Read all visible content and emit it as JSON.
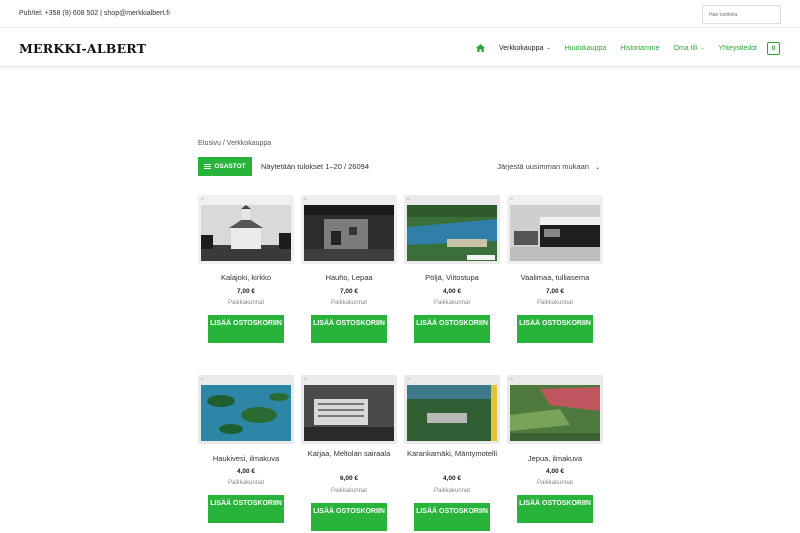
{
  "topbar": {
    "contact": "Puh/tel: +358 (9) 608 502 | shop@merkkialbert.fi",
    "search_placeholder": "Hae tuotteita"
  },
  "header": {
    "logo": "MERKKI-ALBERT",
    "nav": [
      {
        "label": "Verkkokauppa",
        "dropdown": true
      },
      {
        "label": "Huutokauppa"
      },
      {
        "label": "Historiamme"
      },
      {
        "label": "Oma tili",
        "dropdown": true
      },
      {
        "label": "Yhteystiedot"
      }
    ],
    "cart_count": "0"
  },
  "shop": {
    "breadcrumb": "Etusivu / Verkkokauppa",
    "filter_label": "OSASTOT",
    "result_count": "Näytetään tulokset 1–20 / 26094",
    "sort_label": "Järjestä uusimman mukaan"
  },
  "products": [
    {
      "title": "Kalajoki, kirkko",
      "price": "7,00 €",
      "category": "Paikkakunnat",
      "button": "LISÄÄ OSTOSKORIIN",
      "image": "bw-church"
    },
    {
      "title": "Hauho, Lepaa",
      "price": "7,00 €",
      "category": "Paikkakunnat",
      "button": "LISÄÄ OSTOSKORIIN",
      "image": "bw-building"
    },
    {
      "title": "Pöljä, Viitostupa",
      "price": "4,00 €",
      "category": "Paikkakunnat",
      "button": "LISÄÄ OSTOSKORIIN",
      "image": "color-lake-aerial"
    },
    {
      "title": "Vaalimaa, tulliasema",
      "price": "7,00 €",
      "category": "Paikkakunnat",
      "button": "LISÄÄ OSTOSKORIIN",
      "image": "bw-customs"
    },
    {
      "title": "Haukivesi, ilmakuva",
      "price": "4,00 €",
      "category": "Paikkakunnat",
      "button": "LISÄÄ OSTOSKORIIN",
      "image": "color-islands"
    },
    {
      "title": "Karjaa, Meltolan sairaala",
      "price": "6,00 €",
      "category": "Paikkakunnat",
      "button": "LISÄÄ OSTOSKORIIN",
      "image": "bw-hospital"
    },
    {
      "title": "Karankamäki, Mäntymotelli",
      "price": "4,00 €",
      "category": "Paikkakunnat",
      "button": "LISÄÄ OSTOSKORIIN",
      "image": "color-motel"
    },
    {
      "title": "Jepua, ilmakuva",
      "price": "4,00 €",
      "category": "Paikkakunnat",
      "button": "LISÄÄ OSTOSKORIIN",
      "image": "color-fields"
    }
  ],
  "colors": {
    "accent": "#28b33a",
    "link": "#2ba637"
  }
}
